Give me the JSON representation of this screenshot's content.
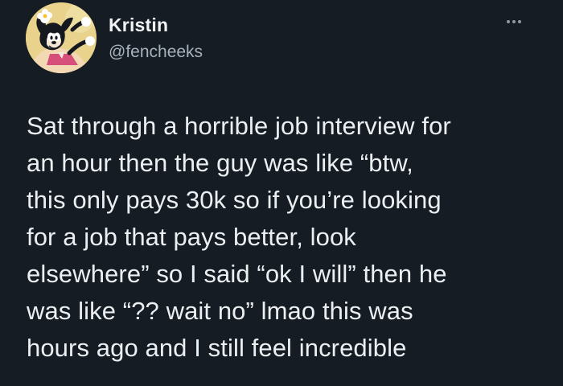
{
  "tweet": {
    "author": {
      "display_name": "Kristin",
      "handle": "@fencheeks",
      "avatar": "animaniacs-dot-avatar"
    },
    "menu_icon": "more-horizontal-icon",
    "text_lines": [
      "Sat through a horrible job interview for",
      "an hour then the guy was like “btw,",
      "this only pays 30k so if you’re looking",
      "for a job that pays better, look",
      "elsewhere” so I said “ok I will” then he",
      "was like “?? wait no” lmao this was",
      "hours ago and I still feel incredible"
    ]
  },
  "colors": {
    "background": "#151c24",
    "text": "#eceff2",
    "secondary_text": "#a8b2bc",
    "avatar_background": "#e9d48b"
  }
}
